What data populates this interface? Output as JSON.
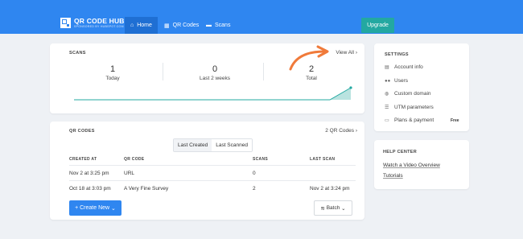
{
  "brand": {
    "name": "QR CODE HUB",
    "tagline": "SPONSORED BY HUBSPOT.COM"
  },
  "nav": [
    {
      "label": "Home",
      "icon": "home-icon"
    },
    {
      "label": "QR Codes",
      "icon": "grid-icon"
    },
    {
      "label": "Scans",
      "icon": "camera-icon"
    }
  ],
  "upgrade_label": "Upgrade",
  "scans": {
    "title": "SCANS",
    "view_all": "View All",
    "stats": [
      {
        "value": "1",
        "label": "Today"
      },
      {
        "value": "0",
        "label": "Last 2 weeks"
      },
      {
        "value": "2",
        "label": "Total"
      }
    ]
  },
  "qr_codes": {
    "title": "QR CODES",
    "count_label": "2 QR Codes",
    "tabs": [
      "Last Created",
      "Last Scanned"
    ],
    "columns": [
      "CREATED AT",
      "QR CODE",
      "SCANS",
      "LAST SCAN"
    ],
    "rows": [
      [
        "Nov 2 at 3:25 pm",
        "URL",
        "0",
        ""
      ],
      [
        "Oct 18 at 3:03 pm",
        "A Very Fine Survey",
        "2",
        "Nov 2 at 3:24 pm"
      ]
    ],
    "create_label": "+ Create New",
    "batch_label": "Batch"
  },
  "settings": {
    "title": "SETTINGS",
    "items": [
      {
        "label": "Account info",
        "icon": "id-card-icon"
      },
      {
        "label": "Users",
        "icon": "users-icon"
      },
      {
        "label": "Custom domain",
        "icon": "globe-icon"
      },
      {
        "label": "UTM parameters",
        "icon": "list-icon"
      },
      {
        "label": "Plans & payment",
        "icon": "credit-card-icon"
      }
    ],
    "free_badge": "Free"
  },
  "help": {
    "title": "HELP CENTER",
    "links": [
      "Watch a Video Overview",
      "Tutorials"
    ]
  },
  "colors": {
    "primary": "#2f86f0",
    "teal": "#23a8a1",
    "arrow": "#f07a3a"
  }
}
